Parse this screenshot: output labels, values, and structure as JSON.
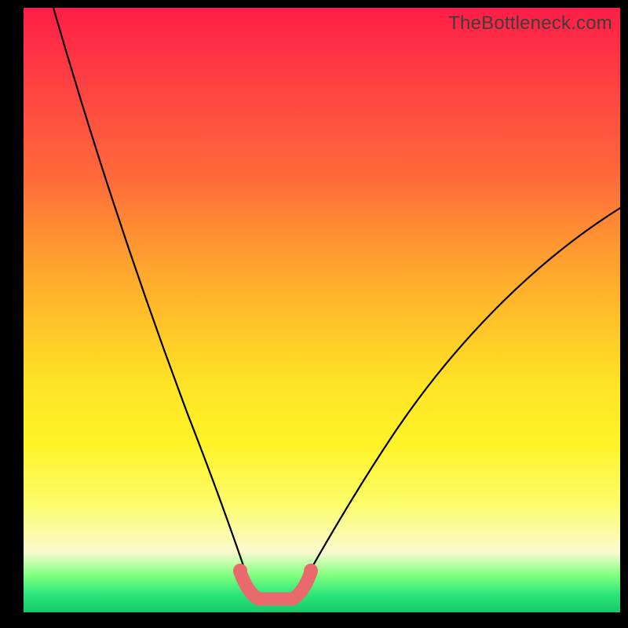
{
  "watermark": "TheBottleneck.com",
  "chart_data": {
    "type": "line",
    "title": "",
    "xlabel": "",
    "ylabel": "",
    "xlim": [
      0,
      100
    ],
    "ylim": [
      0,
      100
    ],
    "series": [
      {
        "name": "left-branch",
        "x": [
          5,
          8,
          12,
          16,
          20,
          24,
          28,
          31,
          33,
          35,
          36.5,
          38
        ],
        "values": [
          100,
          90,
          78,
          66,
          54,
          42,
          30,
          20,
          13,
          8,
          4,
          1
        ]
      },
      {
        "name": "right-branch",
        "x": [
          46,
          48,
          51,
          56,
          62,
          70,
          78,
          86,
          94,
          100
        ],
        "values": [
          1,
          3,
          7,
          14,
          22,
          33,
          43,
          52,
          60,
          66
        ]
      },
      {
        "name": "bottom-band",
        "x": [
          37,
          38.5,
          40,
          42,
          44,
          45.5,
          47
        ],
        "values": [
          4,
          1.5,
          1,
          1,
          1,
          1.5,
          4
        ]
      }
    ],
    "highlight": {
      "name": "optimal-zone",
      "color": "#e9696c",
      "band_x": [
        37,
        47
      ]
    }
  }
}
